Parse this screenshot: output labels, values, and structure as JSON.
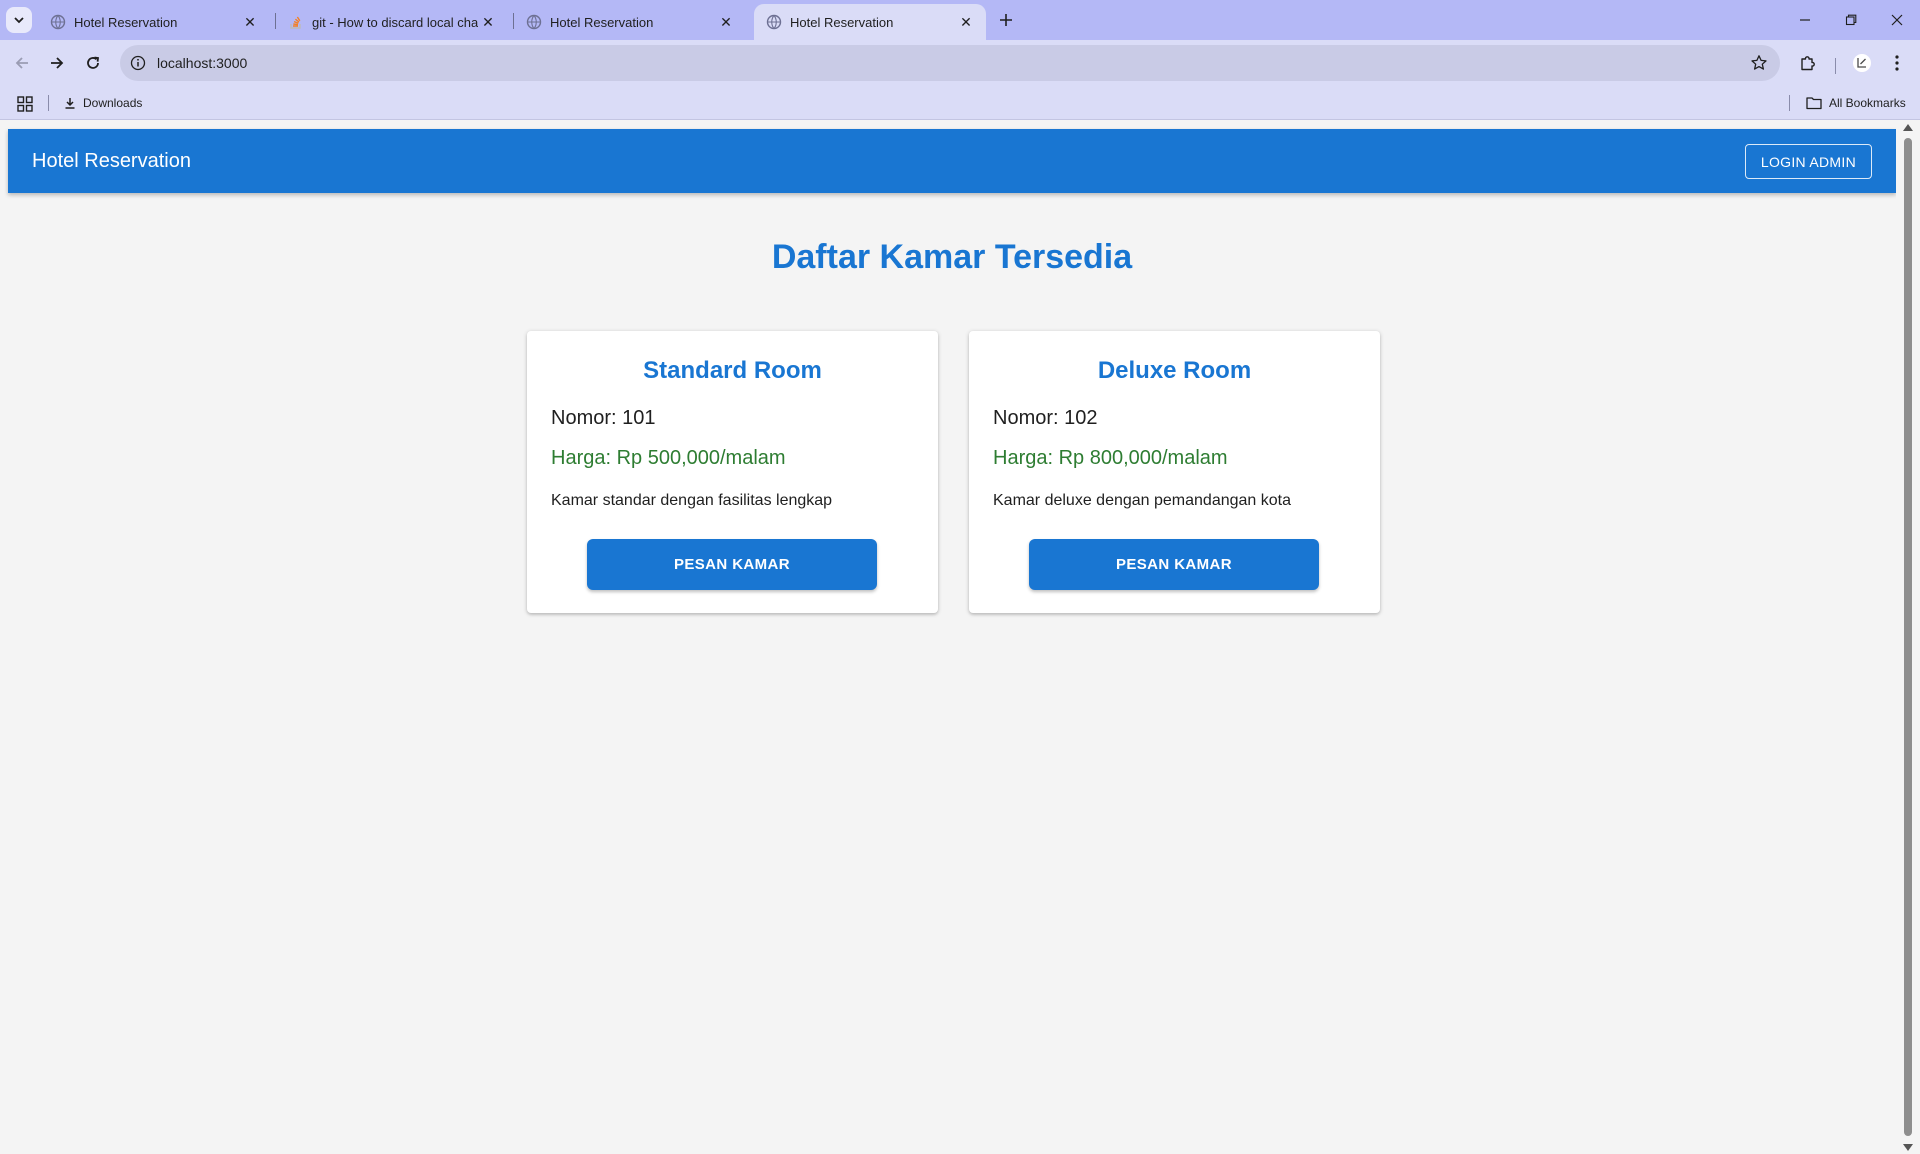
{
  "browser": {
    "tabs": [
      {
        "title": "Hotel Reservation",
        "favicon": "globe-icon",
        "active": false
      },
      {
        "title": "git - How to discard local changes",
        "favicon": "stackoverflow-icon",
        "active": false
      },
      {
        "title": "Hotel Reservation",
        "favicon": "globe-icon",
        "active": false
      },
      {
        "title": "Hotel Reservation",
        "favicon": "globe-icon",
        "active": true
      }
    ],
    "url": "localhost:3000",
    "bookmarks": [
      {
        "label": "Downloads",
        "icon": "download-icon"
      }
    ],
    "all_bookmarks_label": "All Bookmarks",
    "colors": {
      "tabstrip": "#b4b8f6",
      "toolbar": "#dadcf7",
      "omnibox": "#c9cbe6"
    }
  },
  "app": {
    "brand": "Hotel Reservation",
    "login_label": "LOGIN ADMIN",
    "page_title": "Daftar Kamar Tersedia",
    "rooms": [
      {
        "name": "Standard Room",
        "number": "Nomor: 101",
        "price": "Harga: Rp 500,000/malam",
        "description": "Kamar standar dengan fasilitas lengkap",
        "button": "PESAN KAMAR"
      },
      {
        "name": "Deluxe Room",
        "number": "Nomor: 102",
        "price": "Harga: Rp 800,000/malam",
        "description": "Kamar deluxe dengan pemandangan kota",
        "button": "PESAN KAMAR"
      }
    ],
    "colors": {
      "primary": "#1976d2",
      "price": "#2e7d32",
      "background": "#f4f4f4"
    }
  }
}
